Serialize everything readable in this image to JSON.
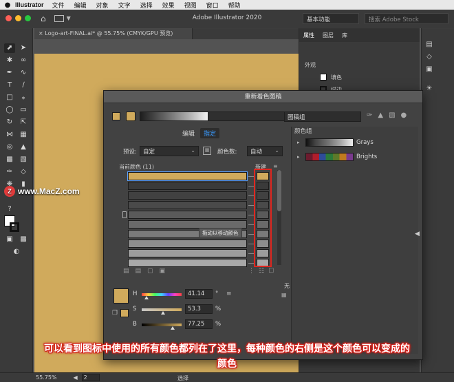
{
  "menubar": {
    "apple": "",
    "app": "Illustrator",
    "items": [
      "文件",
      "编辑",
      "对象",
      "文字",
      "选择",
      "效果",
      "视图",
      "窗口",
      "帮助"
    ]
  },
  "appbar": {
    "title": "Adobe Illustrator 2020",
    "workspace": "基本功能",
    "search_placeholder": "搜索 Adobe Stock"
  },
  "document": {
    "tab": "Logo-art-FINAL.ai* @ 55.75% (CMYK/GPU 预览)"
  },
  "props_panel": {
    "tabs": [
      "属性",
      "图层",
      "库"
    ],
    "appearance": "外观",
    "fill": "填色",
    "stroke": "描边"
  },
  "watermark": "www.MacZ.com",
  "dialog": {
    "title": "重新着色图稿",
    "group_name": "图稿组",
    "tab_edit": "编辑",
    "tab_assign": "指定",
    "preset_label": "预设:",
    "preset_value": "自定",
    "count_label": "颜色数:",
    "count_value": "自动",
    "current_colors": "当前颜色 (11)",
    "new_label": "新建",
    "tooltip": "拖动以移动颜色",
    "none_label": "无",
    "groups_title": "颜色组",
    "groups": [
      "Grays",
      "Brights"
    ],
    "current_bars": [
      "#d0aa5c",
      "#3a3a3a",
      "#414141",
      "#4a4a4a",
      "#5a5a5a",
      "#6a6a6a",
      "#7a7a7a",
      "#8d8d8d",
      "#9c9c9c",
      "#a9a9a9"
    ],
    "new_swatches": [
      "#d0aa5c",
      "#3a3a3a",
      "#414141",
      "#4a4a4a",
      "#5a5a5a",
      "#6a6a6a",
      "#7a7a7a",
      "#8d8d8d",
      "#9c9c9c",
      "#a9a9a9"
    ],
    "sliders": [
      {
        "label": "H",
        "value": "41.14",
        "unit": "°",
        "level": 0.114
      },
      {
        "label": "S",
        "value": "53.3",
        "unit": "%",
        "level": 0.533
      },
      {
        "label": "B",
        "value": "77.25",
        "unit": "%",
        "level": 0.7725
      }
    ]
  },
  "subtitle": {
    "line1": "可以看到图标中使用的所有颜色都列在了这里，每种颜色的右侧是这个颜色可以变成的",
    "line2": "颜色"
  },
  "status": {
    "zoom": "55.75%",
    "page": "2",
    "mode": "选择"
  },
  "colors": {
    "accent": "#3a9bff",
    "highlight": "#e0261f",
    "artboard": "#d0aa5c"
  }
}
